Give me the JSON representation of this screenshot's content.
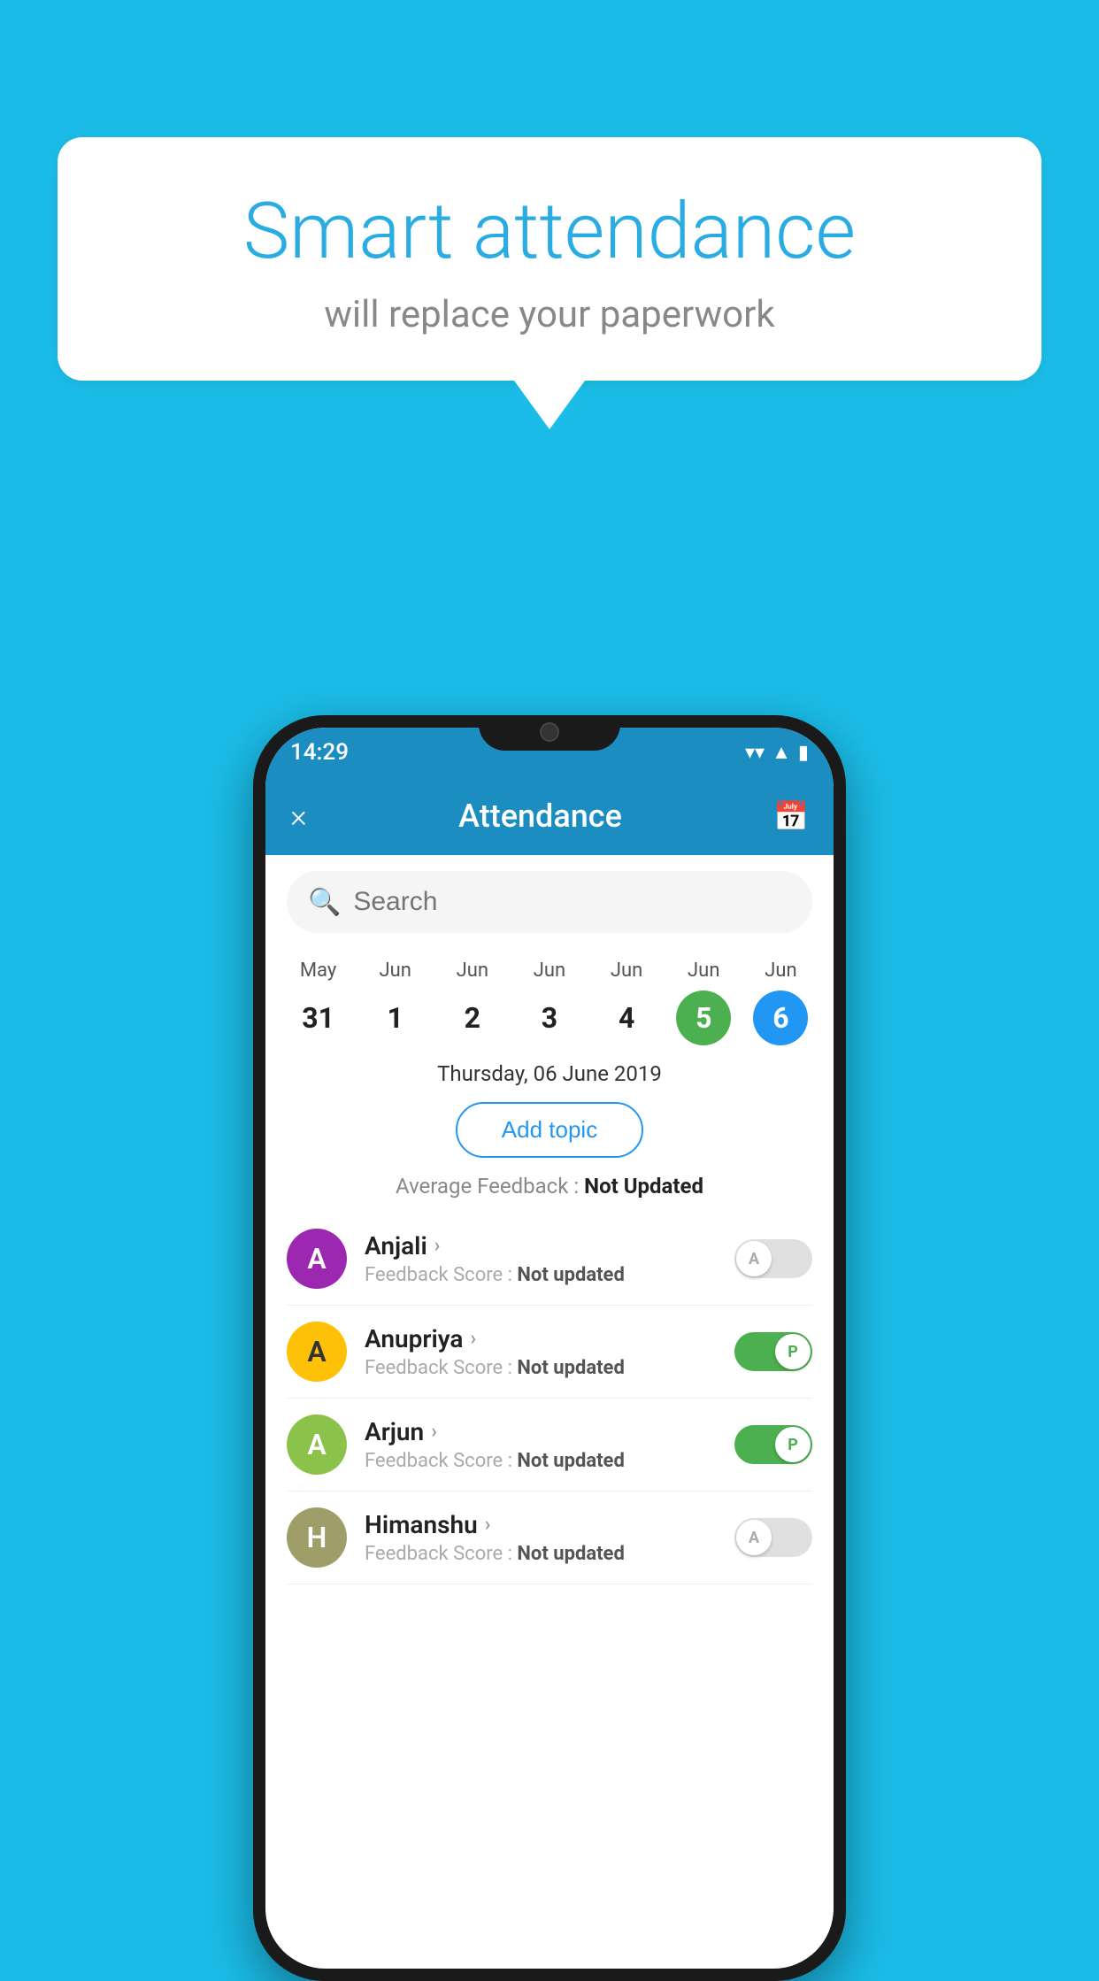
{
  "background_color": "#1BBDE8",
  "bubble": {
    "title": "Smart attendance",
    "subtitle": "will replace your paperwork"
  },
  "status_bar": {
    "time": "14:29",
    "icons": [
      "wifi",
      "signal",
      "battery"
    ]
  },
  "header": {
    "title": "Attendance",
    "close_icon": "×",
    "calendar_icon": "📅"
  },
  "search": {
    "placeholder": "Search"
  },
  "calendar": {
    "days": [
      {
        "month": "May",
        "date": "31",
        "highlight": "none"
      },
      {
        "month": "Jun",
        "date": "1",
        "highlight": "none"
      },
      {
        "month": "Jun",
        "date": "2",
        "highlight": "none"
      },
      {
        "month": "Jun",
        "date": "3",
        "highlight": "none"
      },
      {
        "month": "Jun",
        "date": "4",
        "highlight": "none"
      },
      {
        "month": "Jun",
        "date": "5",
        "highlight": "green"
      },
      {
        "month": "Jun",
        "date": "6",
        "highlight": "blue"
      }
    ]
  },
  "selected_date": "Thursday, 06 June 2019",
  "add_topic_label": "Add topic",
  "avg_feedback_label": "Average Feedback : ",
  "avg_feedback_value": "Not Updated",
  "students": [
    {
      "name": "Anjali",
      "avatar_letter": "A",
      "avatar_color": "purple",
      "feedback_label": "Feedback Score : ",
      "feedback_value": "Not updated",
      "toggle_state": "off",
      "toggle_label": "A"
    },
    {
      "name": "Anupriya",
      "avatar_letter": "A",
      "avatar_color": "amber",
      "feedback_label": "Feedback Score : ",
      "feedback_value": "Not updated",
      "toggle_state": "on",
      "toggle_label": "P"
    },
    {
      "name": "Arjun",
      "avatar_letter": "A",
      "avatar_color": "light-green",
      "feedback_label": "Feedback Score : ",
      "feedback_value": "Not updated",
      "toggle_state": "on",
      "toggle_label": "P"
    },
    {
      "name": "Himanshu",
      "avatar_letter": "H",
      "avatar_color": "olive",
      "feedback_label": "Feedback Score : ",
      "feedback_value": "Not updated",
      "toggle_state": "off",
      "toggle_label": "A"
    }
  ]
}
